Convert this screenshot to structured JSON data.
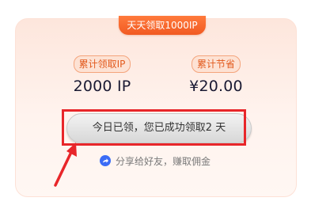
{
  "ribbon": {
    "label": "天天领取1000IP"
  },
  "stats": [
    {
      "label": "累计领取IP",
      "value": "2000 IP"
    },
    {
      "label": "累计节省",
      "value": "¥20.00"
    }
  ],
  "claim_button": {
    "label": "今日已领，您已成功领取2 天"
  },
  "share": {
    "label": "分享给好友，赚取佣金",
    "icon": "share-arrow-icon"
  },
  "colors": {
    "accent": "#f15a22",
    "highlight": "#e8262a",
    "share_icon": "#3b6cf6"
  }
}
